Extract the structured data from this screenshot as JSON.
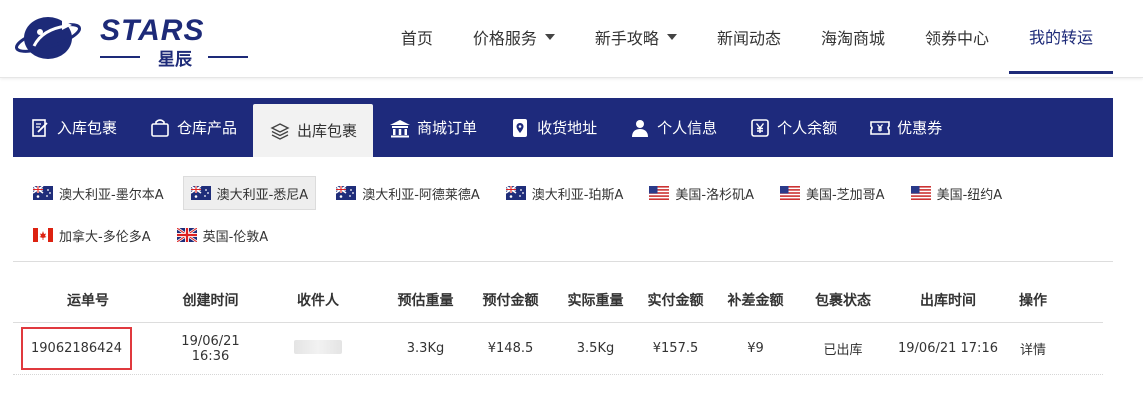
{
  "logo": {
    "text": "STARS",
    "sub": "星辰"
  },
  "nav": {
    "items": [
      {
        "label": "首页",
        "caret": false
      },
      {
        "label": "价格服务",
        "caret": true
      },
      {
        "label": "新手攻略",
        "caret": true
      },
      {
        "label": "新闻动态",
        "caret": false
      },
      {
        "label": "海淘商城",
        "caret": false
      },
      {
        "label": "领券中心",
        "caret": false
      },
      {
        "label": "我的转运",
        "caret": false,
        "active": true
      }
    ]
  },
  "subnav": {
    "items": [
      {
        "label": "入库包裹",
        "icon": "edit-icon"
      },
      {
        "label": "仓库产品",
        "icon": "bag-icon"
      },
      {
        "label": "出库包裹",
        "icon": "layers-icon",
        "active": true
      },
      {
        "label": "商城订单",
        "icon": "building-icon"
      },
      {
        "label": "收货地址",
        "icon": "location-icon"
      },
      {
        "label": "个人信息",
        "icon": "user-icon"
      },
      {
        "label": "个人余额",
        "icon": "yen-icon"
      },
      {
        "label": "优惠券",
        "icon": "ticket-icon"
      }
    ]
  },
  "warehouses": [
    {
      "label": "澳大利亚-墨尔本A",
      "flag": "au"
    },
    {
      "label": "澳大利亚-悉尼A",
      "flag": "au",
      "active": true
    },
    {
      "label": "澳大利亚-阿德莱德A",
      "flag": "au"
    },
    {
      "label": "澳大利亚-珀斯A",
      "flag": "au"
    },
    {
      "label": "美国-洛杉矶A",
      "flag": "us"
    },
    {
      "label": "美国-芝加哥A",
      "flag": "us"
    },
    {
      "label": "美国-纽约A",
      "flag": "us"
    },
    {
      "label": "加拿大-多伦多A",
      "flag": "ca"
    },
    {
      "label": "英国-伦敦A",
      "flag": "uk"
    }
  ],
  "table": {
    "headers": [
      "运单号",
      "创建时间",
      "收件人",
      "预估重量",
      "预付金额",
      "实际重量",
      "实付金额",
      "补差金额",
      "包裹状态",
      "出库时间",
      "操作"
    ],
    "rows": [
      {
        "tracking": "19062186424",
        "created": "19/06/21 16:36",
        "recipient": "",
        "est_weight": "3.3Kg",
        "prepaid": "¥148.5",
        "actual_weight": "3.5Kg",
        "paid": "¥157.5",
        "diff": "¥9",
        "status": "已出库",
        "out_time": "19/06/21 17:16",
        "action": "详情"
      }
    ]
  },
  "colors": {
    "brand": "#1e2a7c",
    "highlight": "#e0393e"
  }
}
